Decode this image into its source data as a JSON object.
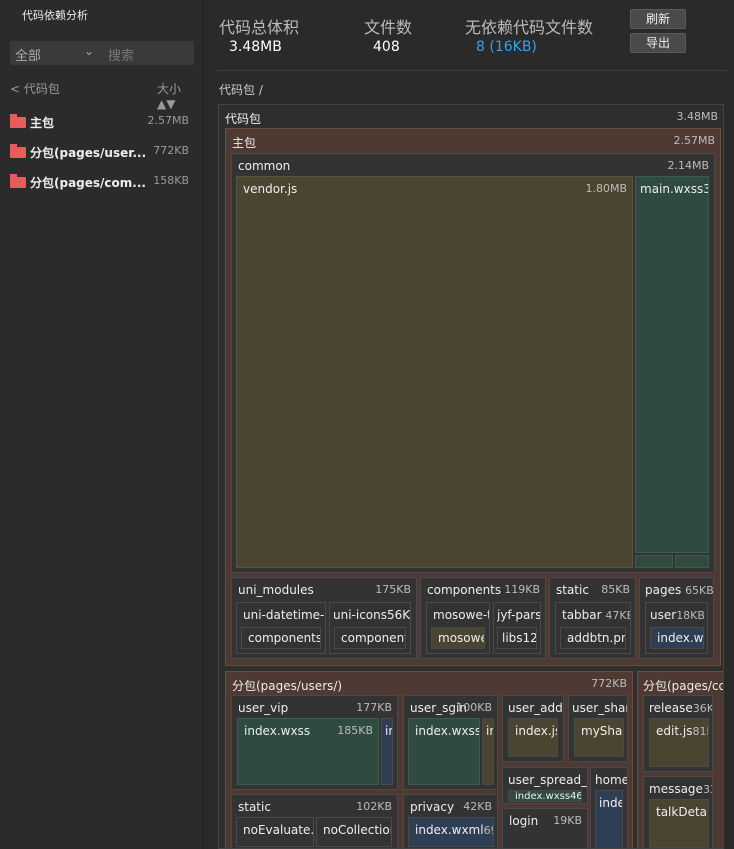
{
  "sidebar": {
    "title": "代码依赖分析",
    "filter": "全部",
    "search_placeholder": "搜索",
    "back_label": "< 代码包",
    "sort_label": "大小 ▲▼",
    "items": [
      {
        "label": "主包",
        "size": "2.57MB"
      },
      {
        "label": "分包(pages/user...",
        "size": "772KB"
      },
      {
        "label": "分包(pages/com...",
        "size": "158KB"
      }
    ]
  },
  "stats": {
    "total_label": "代码总体积",
    "total_value": "3.48MB",
    "files_label": "文件数",
    "files_value": "408",
    "unused_label": "无依赖代码文件数",
    "unused_value": "8 (16KB)"
  },
  "buttons": {
    "refresh": "刷新",
    "export": "导出"
  },
  "breadcrumb": "代码包 /",
  "treemap": {
    "root": {
      "name": "代码包",
      "size": "3.48MB"
    },
    "main": {
      "name": "主包",
      "size": "2.57MB"
    },
    "common": {
      "name": "common",
      "size": "2.14MB"
    },
    "vendor": {
      "name": "vendor.js",
      "size": "1.80MB"
    },
    "mainwxss": {
      "name": "main.wxss",
      "size": "33"
    },
    "uni_modules": {
      "name": "uni_modules",
      "size": "175KB"
    },
    "uni_dt": {
      "name": "uni-datetime-pi"
    },
    "uni_dt_c": {
      "name": "components6"
    },
    "uni_icons": {
      "name": "uni-icons",
      "size": "56KB"
    },
    "uni_icons_c": {
      "name": "components"
    },
    "components": {
      "name": "components",
      "size": "119KB"
    },
    "mosowe": {
      "name": "mosowe-tc"
    },
    "mosowe_c": {
      "name": "mosowe"
    },
    "jyf": {
      "name": "jyf-parse"
    },
    "libs": {
      "name": "libs12"
    },
    "static": {
      "name": "static",
      "size": "85KB"
    },
    "tabbar": {
      "name": "tabbar",
      "size": "47KB"
    },
    "addbtn": {
      "name": "addbtn.png"
    },
    "pages": {
      "name": "pages",
      "size": "65KB"
    },
    "user": {
      "name": "user",
      "size": "18KB"
    },
    "indexwx": {
      "name": "index.wx"
    },
    "sub1": {
      "name": "分包(pages/users/)",
      "size": "772KB"
    },
    "user_vip": {
      "name": "user_vip",
      "size": "177KB"
    },
    "uv_index": {
      "name": "index.wxss",
      "size": "185KB"
    },
    "uv_i": {
      "name": "ir"
    },
    "user_sgin": {
      "name": "user_sgin",
      "size": "100KB"
    },
    "us_index": {
      "name": "index.wxss1("
    },
    "us_i": {
      "name": "ir"
    },
    "user_addre": {
      "name": "user_addre"
    },
    "ua_index": {
      "name": "index.js5"
    },
    "user_share": {
      "name": "user_share"
    },
    "ush_index": {
      "name": "myShare"
    },
    "spread": {
      "name": "user_spread_us"
    },
    "spread_index": {
      "name": "index.wxss46"
    },
    "home": {
      "name": "home"
    },
    "home_idx": {
      "name": "inde"
    },
    "static2": {
      "name": "static",
      "size": "102KB"
    },
    "noeval": {
      "name": "noEvaluate.pr"
    },
    "nocol": {
      "name": "noCollection.p"
    },
    "privacy": {
      "name": "privacy",
      "size": "42KB"
    },
    "priv_idx": {
      "name": "index.wxml",
      "size": "69KI"
    },
    "login": {
      "name": "login",
      "size": "19KB"
    },
    "sub2": {
      "name": "分包(pages/co"
    },
    "release": {
      "name": "release",
      "size": "36KB"
    },
    "rel_edit": {
      "name": "edit.js",
      "size": "81K"
    },
    "message": {
      "name": "message",
      "size": "33K"
    },
    "talk": {
      "name": "talkDetail."
    }
  }
}
